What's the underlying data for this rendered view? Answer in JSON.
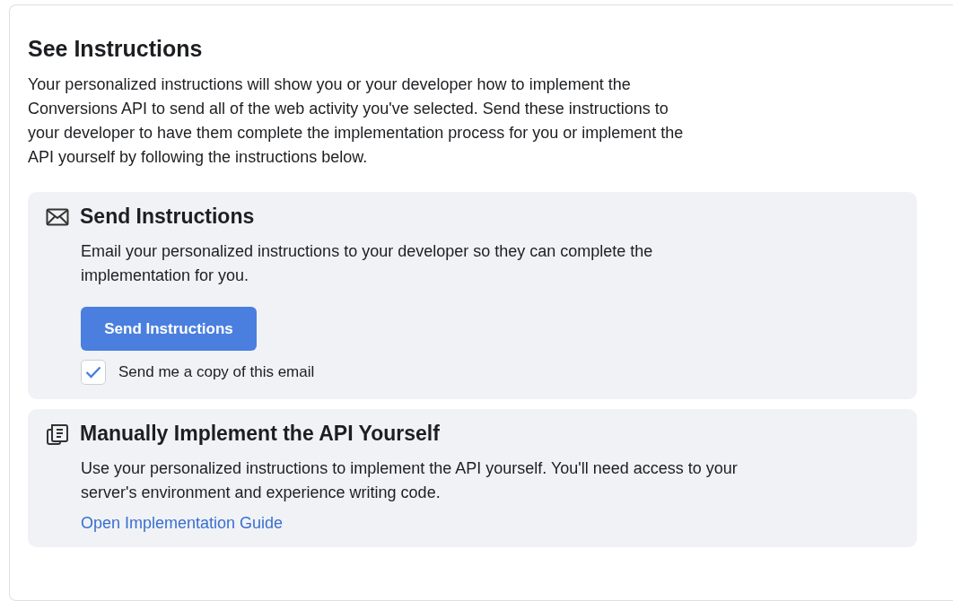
{
  "title": "See Instructions",
  "intro": "Your personalized instructions will show you or your developer how to implement the Conversions API to send all of the web activity you've selected. Send these instructions to your developer to have them complete the implementation process for you or implement the API yourself by following the instructions below.",
  "sections": [
    {
      "kind": "send",
      "title": "Send Instructions",
      "text": "Email your personalized instructions to your developer so they can complete the implementation for you.",
      "button": "Send Instructions",
      "checkbox": {
        "label": "Send me a copy of this email",
        "checked": true
      }
    },
    {
      "kind": "manual",
      "title": "Manually Implement the API Yourself",
      "text": "Use your personalized instructions to implement the API yourself. You'll need access to your server's environment and experience writing code.",
      "link": "Open Implementation Guide"
    }
  ]
}
